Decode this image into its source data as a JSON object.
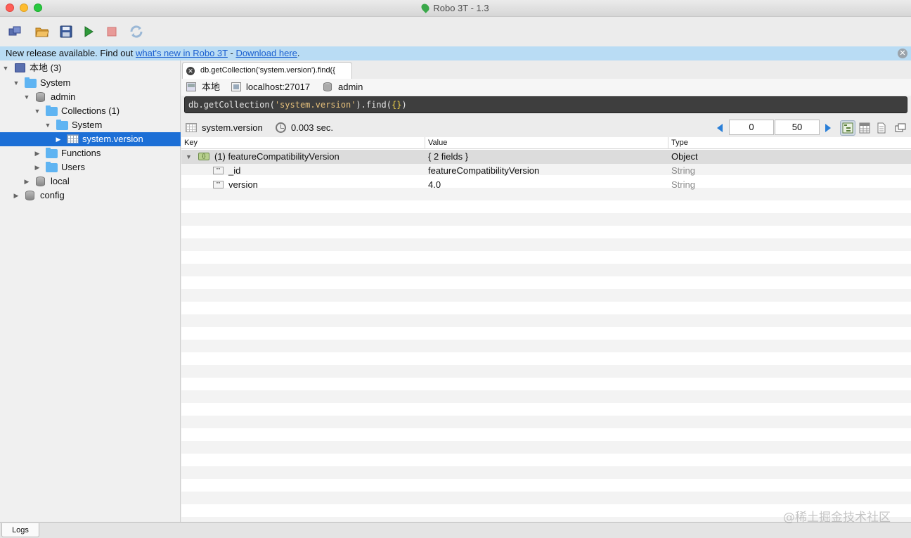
{
  "window": {
    "title": "Robo 3T - 1.3"
  },
  "release": {
    "prefix": "New release available. Find out ",
    "link1": "what's new in Robo 3T",
    "sep": " - ",
    "link2": "Download here",
    "suffix": "."
  },
  "tree": {
    "root": "本地 (3)",
    "system": "System",
    "admin": "admin",
    "collections": "Collections (1)",
    "system_folder": "System",
    "system_version": "system.version",
    "functions": "Functions",
    "users": "Users",
    "local": "local",
    "config": "config"
  },
  "tab": {
    "label": "db.getCollection('system.version').find({"
  },
  "connection": {
    "name": "本地",
    "host": "localhost:27017",
    "database": "admin"
  },
  "query": {
    "prefix": "db.getCollection(",
    "collection": "'system.version'",
    "mid": ").find(",
    "braces": "{}",
    "suffix": ")"
  },
  "result": {
    "collection": "system.version",
    "time": "0.003 sec.",
    "skip": "0",
    "limit": "50"
  },
  "table": {
    "columns": [
      "Key",
      "Value",
      "Type"
    ],
    "rows": [
      {
        "key": "(1) featureCompatibilityVersion",
        "value": "{ 2 fields }",
        "type": "Object"
      },
      {
        "key": "_id",
        "value": "featureCompatibilityVersion",
        "type": "String"
      },
      {
        "key": "version",
        "value": "4.0",
        "type": "String"
      }
    ]
  },
  "bottom": {
    "logs": "Logs"
  },
  "watermark": "@稀土掘金技术社区",
  "icons": {
    "toolbar": [
      "connect-icon",
      "open-icon",
      "save-icon",
      "run-icon",
      "stop-icon",
      "refresh-icon"
    ],
    "views": [
      "tree-view-icon",
      "table-view-icon",
      "text-view-icon",
      "maximize-icon"
    ]
  },
  "colors": {
    "selection": "#1c6fd6",
    "release_bar": "#b9dcf4",
    "link": "#1a5fd0",
    "query_bg": "#3e3e3e"
  }
}
